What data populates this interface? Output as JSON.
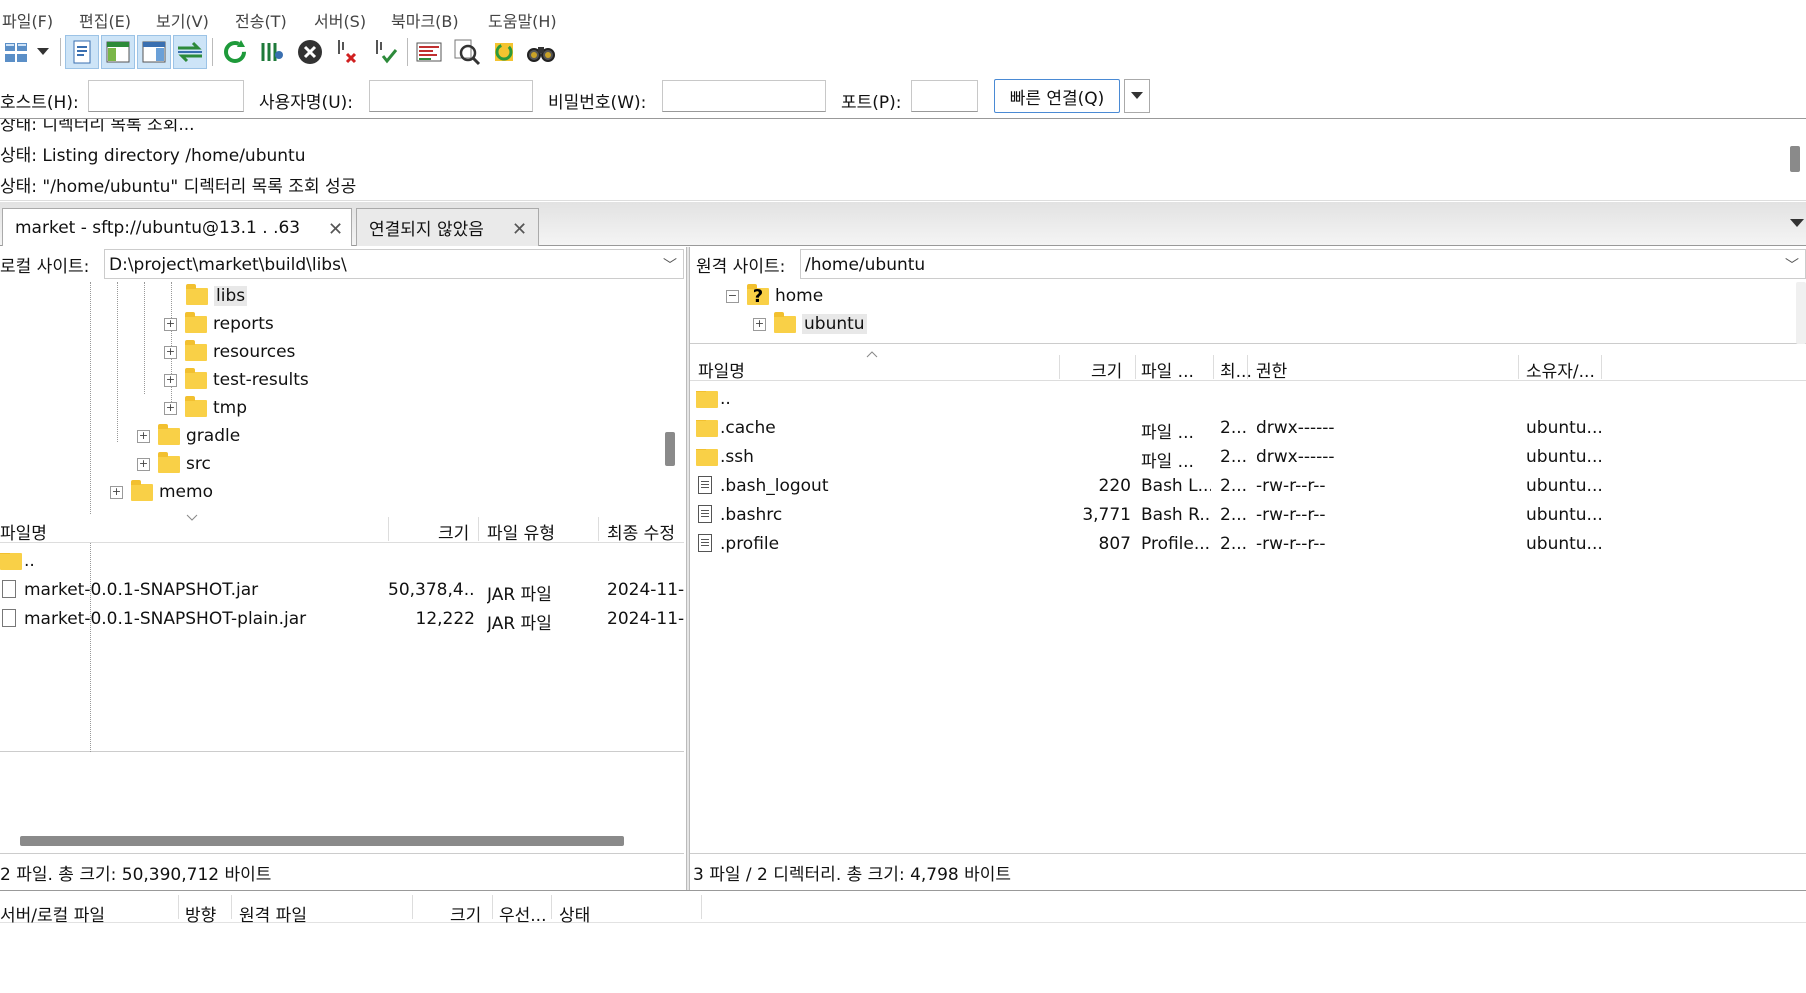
{
  "menu": [
    "파일(F)",
    "편집(E)",
    "보기(V)",
    "전송(T)",
    "서버(S)",
    "북마크(B)",
    "도움말(H)"
  ],
  "toolbar_icons": [
    "site-manager-icon",
    "dropdown-arrow-icon",
    "message-log-icon",
    "local-tree-icon",
    "remote-tree-icon",
    "transfer-queue-icon",
    "refresh-icon",
    "filter-icon",
    "cancel-icon",
    "disconnect-icon",
    "reconnect-icon",
    "directory-compare-icon",
    "search-remote-icon",
    "sync-browse-icon",
    "find-files-icon"
  ],
  "quickconnect": {
    "host_label": "호스트(H):",
    "user_label": "사용자명(U):",
    "pass_label": "비밀번호(W):",
    "port_label": "포트(P):",
    "host_value": "",
    "user_value": "",
    "pass_value": "",
    "port_value": "",
    "connect_label": "빠른 연결(Q)"
  },
  "log": [
    "상태:   디렉터리 목록 조회...",
    "상태:  Listing directory /home/ubuntu",
    "상태:  \"/home/ubuntu\" 디렉터리 목록 조회 성공"
  ],
  "tabs": [
    {
      "label": "market - sftp://ubuntu@13.1 .  .63"
    },
    {
      "label": "연결되지 않았음"
    }
  ],
  "local": {
    "site_label": "로컬 사이트:",
    "path": "D:\\project\\market\\build\\libs\\",
    "tree": [
      "libs",
      "reports",
      "resources",
      "test-results",
      "tmp",
      "gradle",
      "src",
      "memo"
    ],
    "columns": {
      "name": "파일명",
      "size": "크기",
      "type": "파일 유형",
      "modified": "최종 수정"
    },
    "files": [
      {
        "name": "..",
        "size": "",
        "type": "",
        "modified": ""
      },
      {
        "name": "market-0.0.1-SNAPSHOT.jar",
        "size": "50,378,4...",
        "type": "JAR 파일",
        "modified": "2024-11-"
      },
      {
        "name": "market-0.0.1-SNAPSHOT-plain.jar",
        "size": "12,222",
        "type": "JAR 파일",
        "modified": "2024-11-"
      }
    ],
    "status": "2 파일. 총 크기: 50,390,712 바이트"
  },
  "remote": {
    "site_label": "원격 사이트:",
    "path": "/home/ubuntu",
    "tree": [
      "home",
      "ubuntu"
    ],
    "columns": {
      "name": "파일명",
      "size": "크기",
      "type": "파일 ...",
      "modified": "최...",
      "perm": "권한",
      "owner": "소유자/..."
    },
    "files": [
      {
        "name": "..",
        "size": "",
        "type": "",
        "modified": "",
        "perm": "",
        "owner": ""
      },
      {
        "name": ".cache",
        "size": "",
        "type": "파일 ...",
        "modified": "2...",
        "perm": "drwx------",
        "owner": "ubuntu..."
      },
      {
        "name": ".ssh",
        "size": "",
        "type": "파일 ...",
        "modified": "2...",
        "perm": "drwx------",
        "owner": "ubuntu..."
      },
      {
        "name": ".bash_logout",
        "size": "220",
        "type": "Bash L...",
        "modified": "2...",
        "perm": "-rw-r--r--",
        "owner": "ubuntu..."
      },
      {
        "name": ".bashrc",
        "size": "3,771",
        "type": "Bash R...",
        "modified": "2...",
        "perm": "-rw-r--r--",
        "owner": "ubuntu..."
      },
      {
        "name": ".profile",
        "size": "807",
        "type": "Profile...",
        "modified": "2...",
        "perm": "-rw-r--r--",
        "owner": "ubuntu..."
      }
    ],
    "status": "3 파일 / 2 디렉터리. 총 크기: 4,798 바이트"
  },
  "queue": {
    "columns": [
      "서버/로컬 파일",
      "방향",
      "원격 파일",
      "크기",
      "우선...",
      "상태"
    ]
  }
}
